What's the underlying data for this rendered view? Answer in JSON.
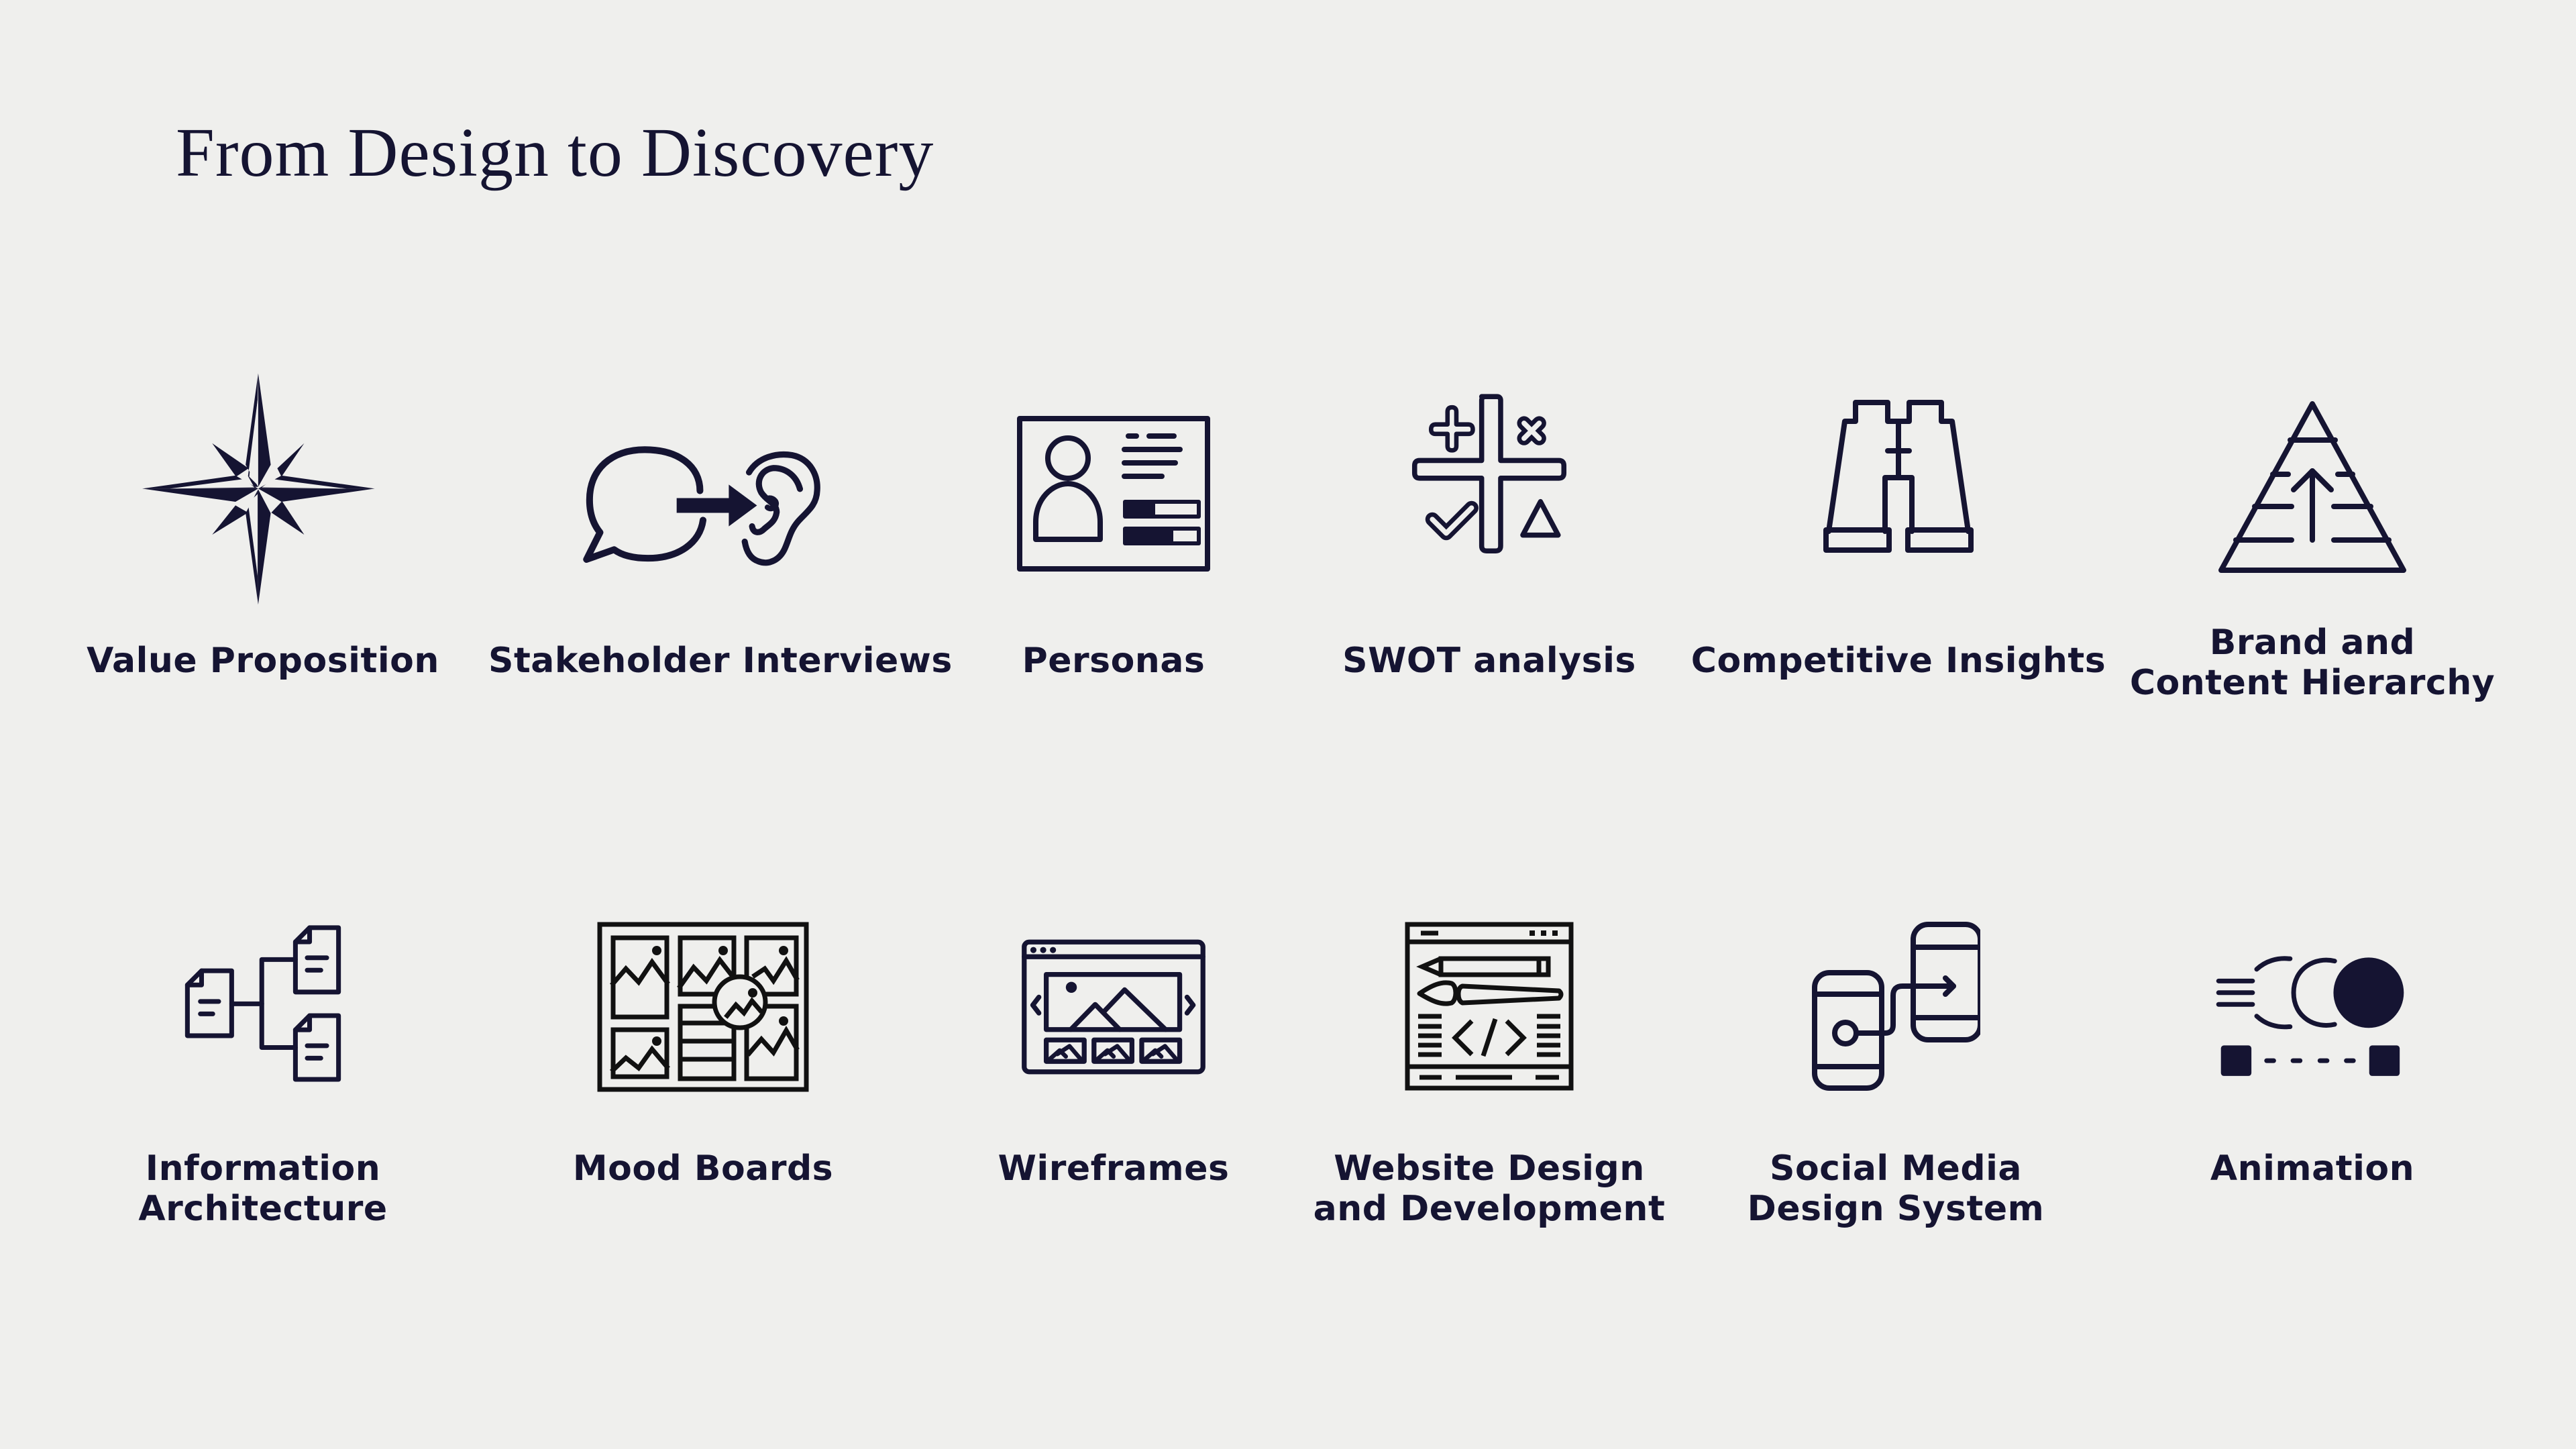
{
  "page": {
    "title": "From Design to Discovery",
    "colors": {
      "background": "#efefed",
      "ink": "#151432"
    }
  },
  "services": [
    {
      "id": "value-proposition",
      "icon": "compass-star-icon",
      "lines": [
        "Value Proposition"
      ]
    },
    {
      "id": "stakeholder-interviews",
      "icon": "speech-to-ear-icon",
      "lines": [
        "Stakeholder Interviews"
      ]
    },
    {
      "id": "personas",
      "icon": "persona-card-icon",
      "lines": [
        "Personas"
      ]
    },
    {
      "id": "swot-analysis",
      "icon": "swot-quadrant-icon",
      "lines": [
        "SWOT analysis"
      ]
    },
    {
      "id": "competitive-insights",
      "icon": "binoculars-icon",
      "lines": [
        "Competitive Insights"
      ]
    },
    {
      "id": "brand-content-hierarchy",
      "icon": "pyramid-hierarchy-icon",
      "lines": [
        "Brand and",
        "Content Hierarchy"
      ]
    },
    {
      "id": "information-architecture",
      "icon": "document-tree-icon",
      "lines": [
        "Information",
        "Architecture"
      ]
    },
    {
      "id": "mood-boards",
      "icon": "mood-board-icon",
      "lines": [
        "Mood Boards"
      ]
    },
    {
      "id": "wireframes",
      "icon": "browser-gallery-icon",
      "lines": [
        "Wireframes"
      ]
    },
    {
      "id": "website-design-development",
      "icon": "browser-code-icon",
      "lines": [
        "Website Design",
        "and Development"
      ]
    },
    {
      "id": "social-media-design-system",
      "icon": "phone-flow-icon",
      "lines": [
        "Social Media",
        "Design System"
      ]
    },
    {
      "id": "animation",
      "icon": "motion-circle-icon",
      "lines": [
        "Animation"
      ]
    }
  ]
}
